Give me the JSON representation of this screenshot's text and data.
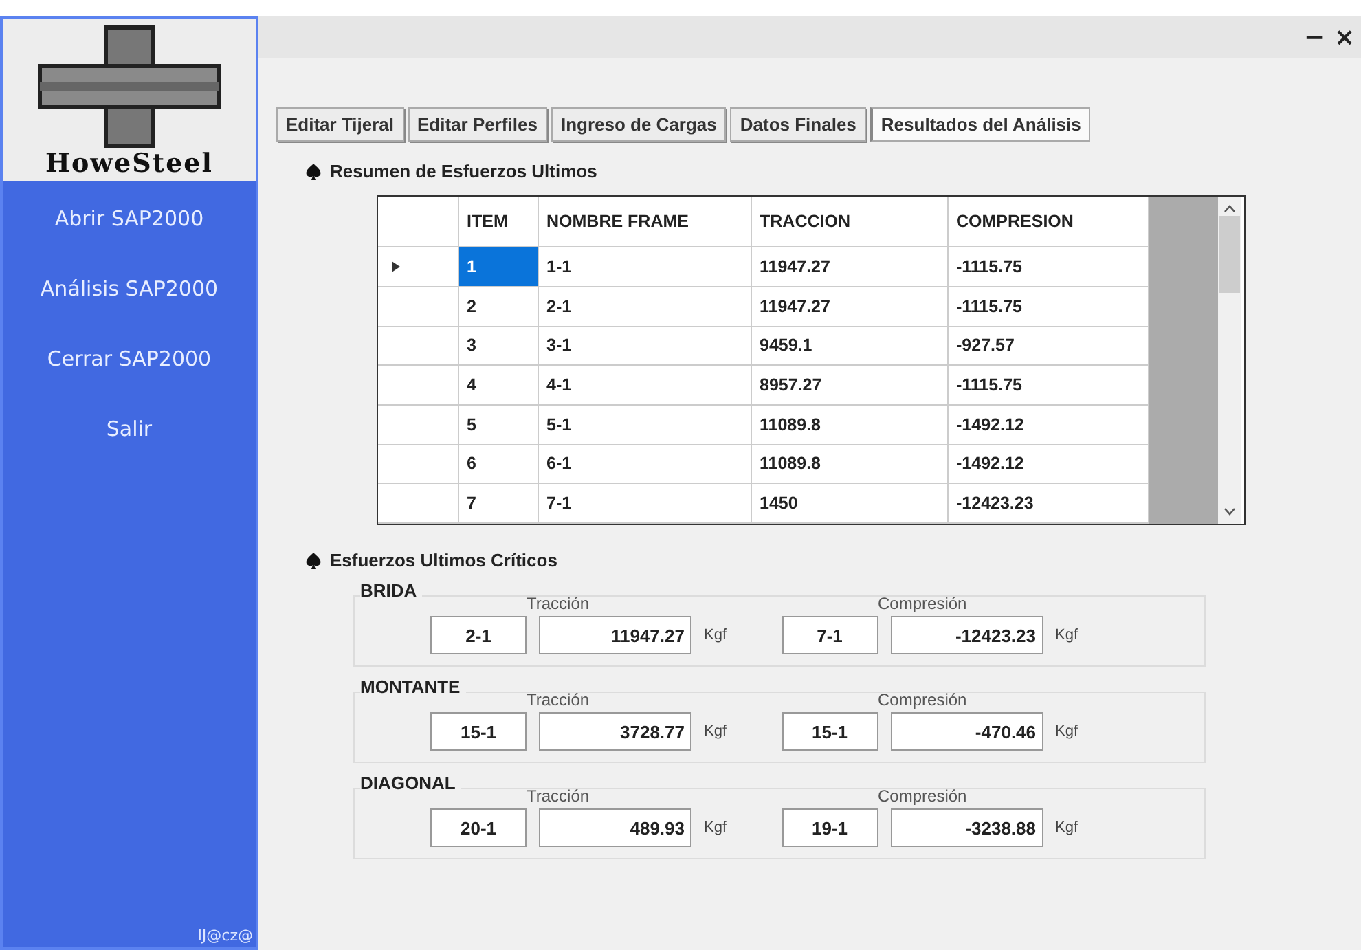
{
  "window": {
    "controls": [
      "−",
      "×"
    ]
  },
  "sidebar": {
    "logo_text": "HoweSteel",
    "items": [
      "Abrir SAP2000",
      "Análisis SAP2000",
      "Cerrar SAP2000",
      "Salir"
    ],
    "footer": "IJ@cz@"
  },
  "tabs": [
    {
      "label": "Editar Tijeral",
      "selected": false
    },
    {
      "label": "Editar Perfiles",
      "selected": false
    },
    {
      "label": "Ingreso de Cargas",
      "selected": false
    },
    {
      "label": "Datos Finales",
      "selected": false
    },
    {
      "label": "Resultados del Análisis",
      "selected": true
    }
  ],
  "summary": {
    "title": "Resumen de Esfuerzos Ultimos",
    "columns": [
      "ITEM",
      "NOMBRE FRAME",
      "TRACCION",
      "COMPRESION"
    ],
    "rows": [
      {
        "cells": [
          "1",
          "1-1",
          "11947.27",
          "-1115.75"
        ],
        "selected": true
      },
      {
        "cells": [
          "2",
          "2-1",
          "11947.27",
          "-1115.75"
        ],
        "selected": false
      },
      {
        "cells": [
          "3",
          "3-1",
          "9459.1",
          "-927.57"
        ],
        "selected": false
      },
      {
        "cells": [
          "4",
          "4-1",
          "8957.27",
          "-1115.75"
        ],
        "selected": false
      },
      {
        "cells": [
          "5",
          "5-1",
          "11089.8",
          "-1492.12"
        ],
        "selected": false
      },
      {
        "cells": [
          "6",
          "6-1",
          "11089.8",
          "-1492.12"
        ],
        "selected": false
      },
      {
        "cells": [
          "7",
          "7-1",
          "1450",
          "-12423.23"
        ],
        "selected": false
      }
    ]
  },
  "critical": {
    "title": "Esfuerzos Ultimos Críticos",
    "groups": [
      {
        "title": "BRIDA",
        "traccion": {
          "label": "Tracción",
          "frame": "2-1",
          "value": "11947.27",
          "unit": "Kgf"
        },
        "compresion": {
          "label": "Compresión",
          "frame": "7-1",
          "value": "-12423.23",
          "unit": "Kgf"
        }
      },
      {
        "title": "MONTANTE",
        "traccion": {
          "label": "Tracción",
          "frame": "15-1",
          "value": "3728.77",
          "unit": "Kgf"
        },
        "compresion": {
          "label": "Compresión",
          "frame": "15-1",
          "value": "-470.46",
          "unit": "Kgf"
        }
      },
      {
        "title": "DIAGONAL",
        "traccion": {
          "label": "Tracción",
          "frame": "20-1",
          "value": "489.93",
          "unit": "Kgf"
        },
        "compresion": {
          "label": "Compresión",
          "frame": "19-1",
          "value": "-3238.88",
          "unit": "Kgf"
        }
      }
    ]
  }
}
